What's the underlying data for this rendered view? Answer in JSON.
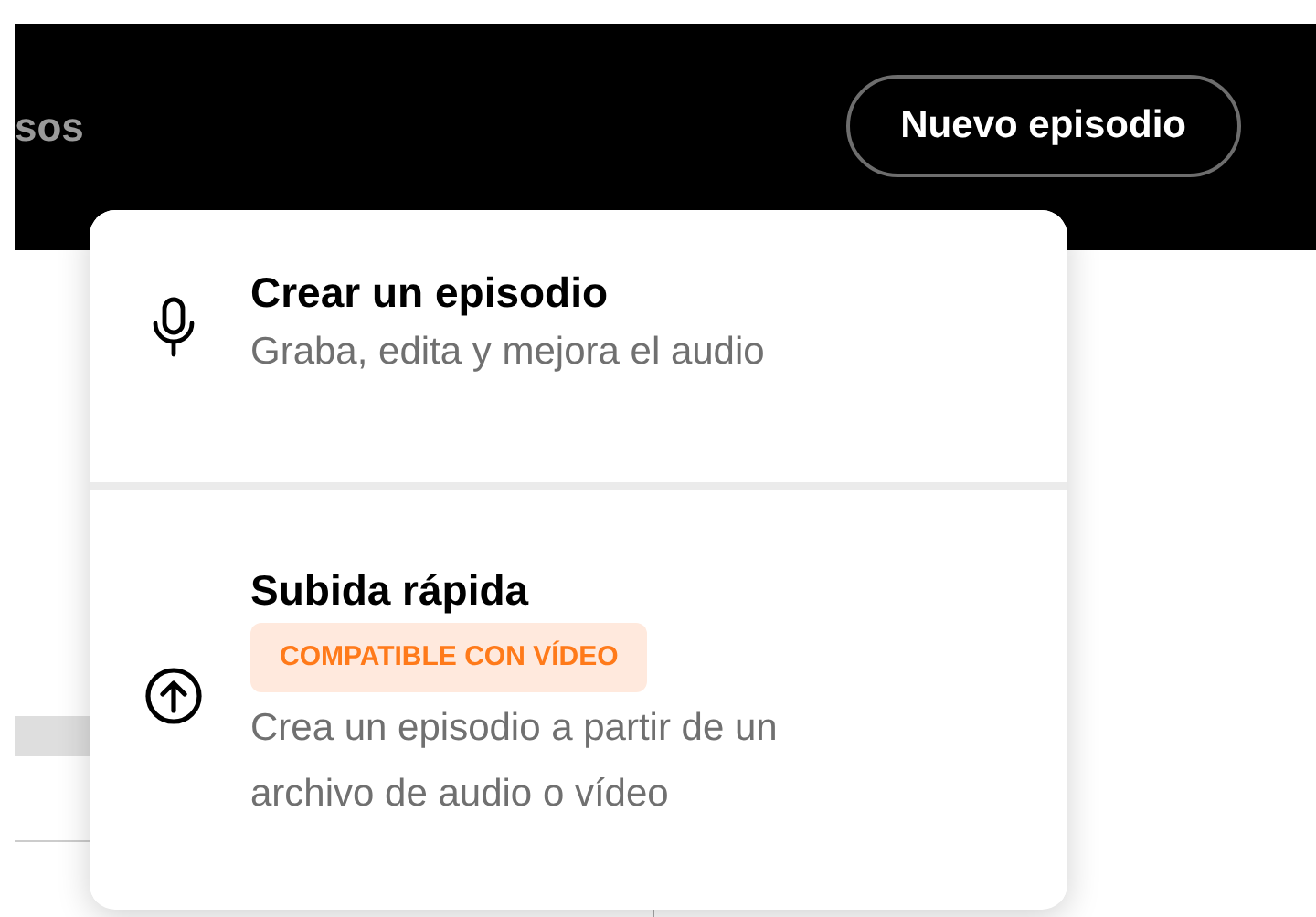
{
  "header": {
    "nav_text": "sos",
    "new_button": "Nuevo episodio"
  },
  "menu": {
    "items": [
      {
        "title": "Crear un episodio",
        "description": "Graba, edita y mejora el audio"
      },
      {
        "title": "Subida rápida",
        "badge": "COMPATIBLE CON VÍDEO",
        "description": "Crea un episodio a partir de un archivo de audio o vídeo"
      }
    ]
  }
}
